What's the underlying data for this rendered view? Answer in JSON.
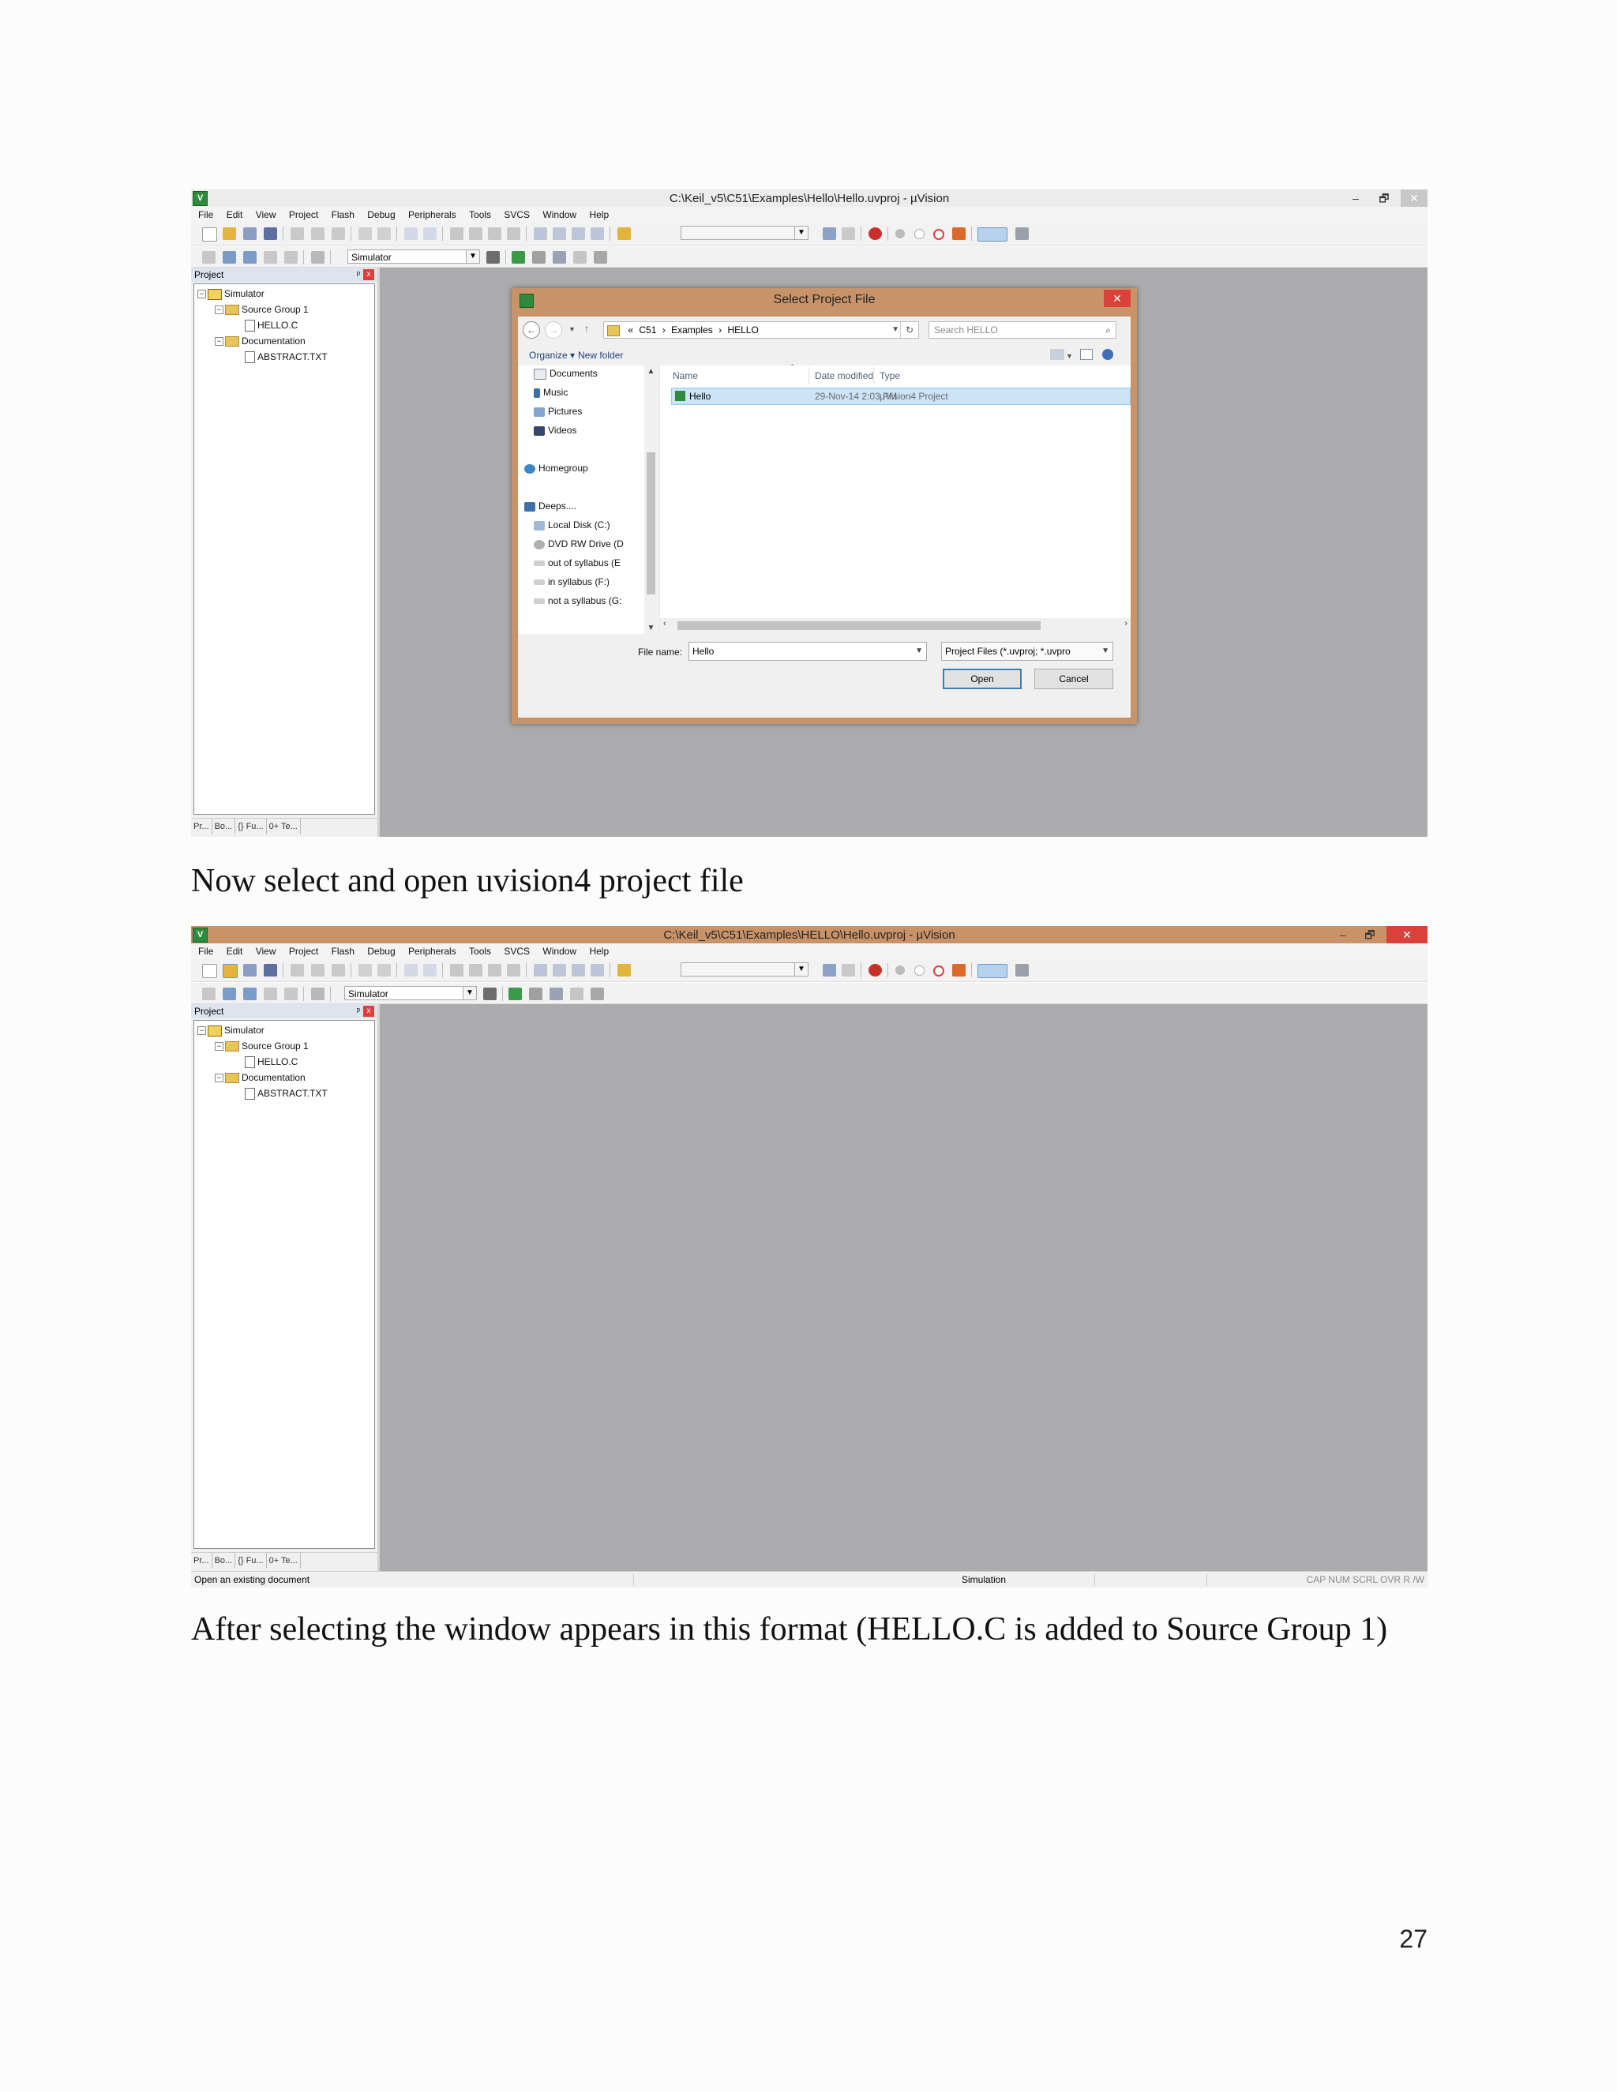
{
  "screenshot1": {
    "window_title": "C:\\Keil_v5\\C51\\Examples\\Hello\\Hello.uvproj - µVision",
    "minimize": "–",
    "restore": "🗗",
    "close": "✕",
    "menu": [
      "File",
      "Edit",
      "View",
      "Project",
      "Flash",
      "Debug",
      "Peripherals",
      "Tools",
      "SVCS",
      "Window",
      "Help"
    ],
    "target_combo": "Simulator",
    "project_panel": {
      "title": "Project",
      "pin": "ᵖ",
      "close": "x",
      "tree": {
        "target": "Simulator",
        "group1": "Source Group 1",
        "file1": "HELLO.C",
        "group2": "Documentation",
        "file2": "ABSTRACT.TXT"
      },
      "tabs": [
        "Pr...",
        "Bo...",
        "{} Fu...",
        "0+ Te..."
      ]
    },
    "dialog": {
      "title": "Select Project File",
      "close": "✕",
      "breadcrumb": [
        "«",
        "C51",
        "›",
        "Examples",
        "›",
        "HELLO"
      ],
      "search_placeholder": "Search HELLO",
      "organize": "Organize ▾",
      "new_folder": "New folder",
      "nav_items": [
        "Documents",
        "Music",
        "Pictures",
        "Videos",
        "Homegroup",
        "Deeps....",
        "Local Disk (C:)",
        "DVD RW Drive (D",
        "out of syllabus (E",
        "in syllabus (F:)",
        "not a syllabus (G:"
      ],
      "columns": {
        "name": "Name",
        "date": "Date modified",
        "type": "Type"
      },
      "file": {
        "name": "Hello",
        "date": "29-Nov-14 2:03 PM",
        "type": "µVision4 Project"
      },
      "file_name_label": "File name:",
      "file_name_value": "Hello",
      "file_type_value": "Project Files (*.uvproj; *.uvpro",
      "open_button": "Open",
      "cancel_button": "Cancel"
    }
  },
  "caption1": "Now select and open uvision4 project file",
  "screenshot2": {
    "window_title": "C:\\Keil_v5\\C51\\Examples\\HELLO\\Hello.uvproj - µVision",
    "minimize": "–",
    "restore": "🗗",
    "close": "✕",
    "menu": [
      "File",
      "Edit",
      "View",
      "Project",
      "Flash",
      "Debug",
      "Peripherals",
      "Tools",
      "SVCS",
      "Window",
      "Help"
    ],
    "target_combo": "Simulator",
    "project_panel": {
      "title": "Project",
      "pin": "ᵖ",
      "close": "x",
      "tree": {
        "target": "Simulator",
        "group1": "Source Group 1",
        "file1": "HELLO.C",
        "group2": "Documentation",
        "file2": "ABSTRACT.TXT"
      },
      "tabs": [
        "Pr...",
        "Bo...",
        "{} Fu...",
        "0+ Te..."
      ]
    },
    "status": {
      "left": "Open an existing document",
      "middle": "Simulation",
      "right": "CAP  NUM  SCRL  OVR  R /W"
    }
  },
  "caption2": "After selecting the window appears in this format (HELLO.C is added to Source Group 1)",
  "page_number": "27",
  "colors": {
    "keil_green": "#2e8b3e",
    "dialog_frame": "#c9936a",
    "work_area": "#abaaac",
    "selection": "#cce4f7"
  }
}
